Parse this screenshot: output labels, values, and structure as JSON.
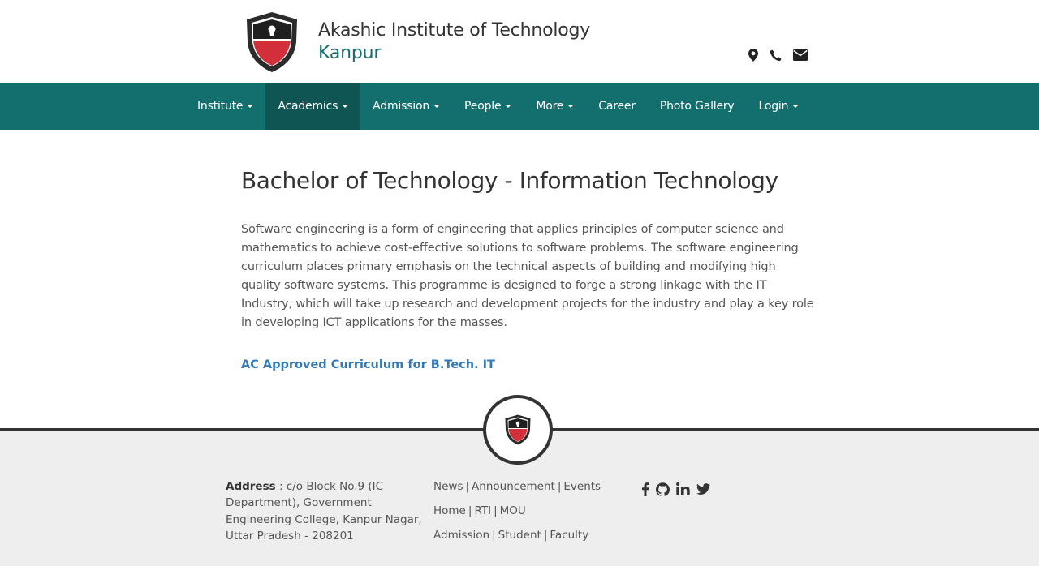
{
  "header": {
    "institute_name": "Akashic Institute of Technology",
    "city": "Kanpur",
    "icons": [
      "map-marker-icon",
      "phone-icon",
      "envelope-icon"
    ]
  },
  "nav": {
    "items": [
      {
        "label": "Institute",
        "dropdown": true,
        "active": false
      },
      {
        "label": "Academics",
        "dropdown": true,
        "active": true
      },
      {
        "label": "Admission",
        "dropdown": true,
        "active": false
      },
      {
        "label": "People",
        "dropdown": true,
        "active": false
      },
      {
        "label": "More",
        "dropdown": true,
        "active": false
      },
      {
        "label": "Career",
        "dropdown": false,
        "active": false
      },
      {
        "label": "Photo Gallery",
        "dropdown": false,
        "active": false
      },
      {
        "label": "Login",
        "dropdown": true,
        "active": false
      }
    ]
  },
  "main": {
    "title": "Bachelor of Technology - Information Technology",
    "description": "Software engineering is a form of engineering that applies principles of computer science and mathematics to achieve cost-effective solutions to software problems. The software engineering curriculum places primary emphasis on the technical aspects of building and modifying high quality software systems. This programme is designed to forge a strong linkage with the IT Industry, which will take up research and development projects for the industry and play a key role in developing ICT applications for the masses.",
    "curriculum_link": "AC Approved Curriculum for B.Tech. IT"
  },
  "footer": {
    "address_label": "Address",
    "address_text": " : c/o Block No.9 (IC Department), Government Engineering College, Kanpur Nagar, Uttar Pradesh - 208201",
    "links": {
      "row1": [
        "News",
        "Announcement",
        "Events"
      ],
      "row2": [
        "Home",
        "RTI",
        "MOU"
      ],
      "row3": [
        "Admission",
        "Student",
        "Faculty"
      ]
    },
    "social_icons": [
      "facebook-icon",
      "github-icon",
      "linkedin-icon",
      "twitter-icon"
    ]
  },
  "colors": {
    "brand_teal": "#136f6d",
    "nav_active": "#0e5553",
    "link_blue": "#337ab7",
    "shield_red": "#d32f3a"
  }
}
